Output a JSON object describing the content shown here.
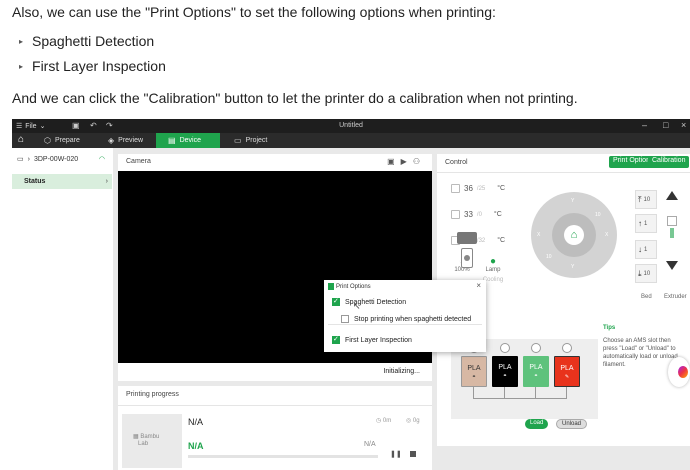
{
  "article": {
    "intro": "Also, we can use the \"Print Options\" to set the following options when printing:",
    "bullets": [
      "Spaghetti Detection",
      "First Layer Inspection"
    ],
    "outro": "And we can click the \"Calibration\" button to let the printer do a calibration when not printing."
  },
  "app": {
    "menu_label": "File",
    "window_title": "Untitled",
    "tabs": [
      {
        "label": "Prepare",
        "icon": "cube-icon"
      },
      {
        "label": "Preview",
        "icon": "layers-icon"
      },
      {
        "label": "Device",
        "icon": "device-icon",
        "active": true
      },
      {
        "label": "Project",
        "icon": "project-icon"
      }
    ],
    "accent_color": "#1fa44d",
    "sidebar": {
      "device_name": "3DP-00W-020",
      "status_label": "Status"
    },
    "camera": {
      "header": "Camera",
      "status": "Initializing..."
    },
    "progress": {
      "header": "Printing progress",
      "logo_text_1": "Bambu",
      "logo_text_2": "Lab",
      "name": "N/A",
      "time": "0m",
      "weight": "0g",
      "percent": "N/A",
      "layers": "N/A"
    },
    "control": {
      "header": "Control",
      "print_options_btn": "Print Options",
      "calibration_btn": "Calibration",
      "temps": [
        {
          "current": "36",
          "target": "/25",
          "unit": "°C"
        },
        {
          "current": "33",
          "target": "/0",
          "unit": "°C"
        },
        {
          "current": "32",
          "target": "/32",
          "unit": "°C"
        }
      ],
      "fan_speed": "100%",
      "lamp_label": "Lamp",
      "cooling_label": "Cooling",
      "z_steps": [
        "10",
        "1",
        "1",
        "10"
      ],
      "bed_label": "Bed",
      "extruder_label": "Extruder",
      "ams_slots": [
        {
          "label": "PLA",
          "color": "#d7b8a4"
        },
        {
          "label": "PLA",
          "color": "#000000"
        },
        {
          "label": "PLA",
          "color": "#5ec27c"
        },
        {
          "label": "PLA",
          "color": "#e8331c"
        }
      ],
      "tips_title": "Tips",
      "tips_text": "Choose an AMS slot then press \"Load\" or \"Unload\" to automatically load or unload filament.",
      "load_btn": "Load",
      "unload_btn": "Unload"
    },
    "dialog": {
      "title": "Print Options",
      "options": [
        {
          "label": "Spaghetti Detection",
          "checked": true
        },
        {
          "label": "Stop printing when spaghetti detected",
          "checked": false
        },
        {
          "label": "First Layer Inspection",
          "checked": true
        }
      ]
    }
  }
}
